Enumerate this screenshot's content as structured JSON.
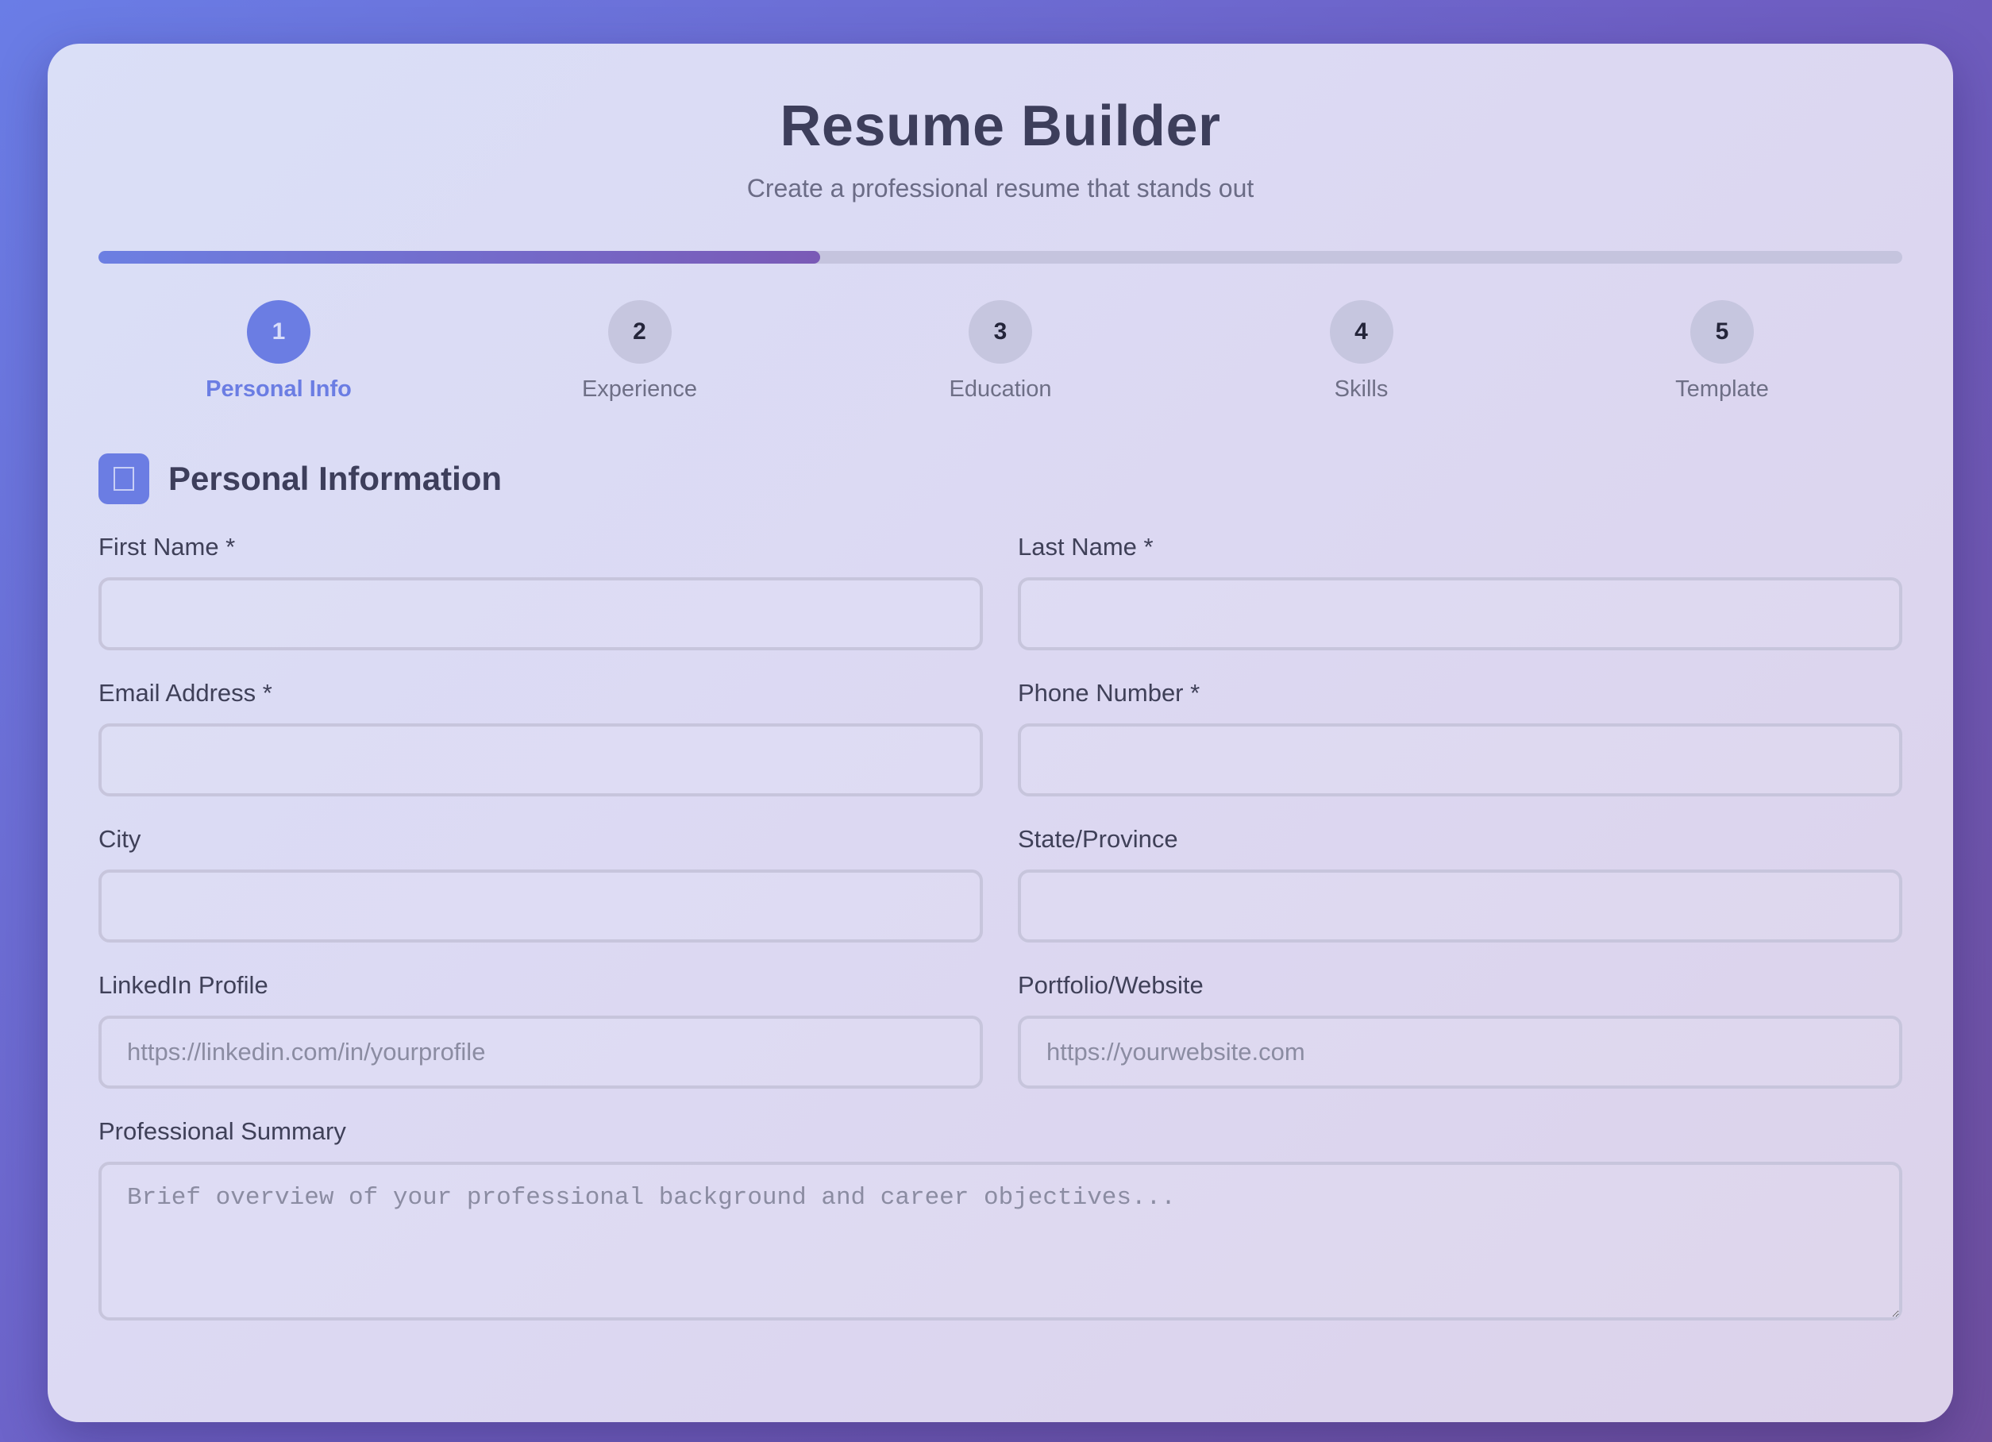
{
  "header": {
    "title": "Resume Builder",
    "subtitle": "Create a professional resume that stands out"
  },
  "progress": {
    "fraction": 0.4
  },
  "steps": [
    {
      "number": "1",
      "label": "Personal Info",
      "active": true
    },
    {
      "number": "2",
      "label": "Experience",
      "active": false
    },
    {
      "number": "3",
      "label": "Education",
      "active": false
    },
    {
      "number": "4",
      "label": "Skills",
      "active": false
    },
    {
      "number": "5",
      "label": "Template",
      "active": false
    }
  ],
  "section": {
    "title": "Personal Information",
    "icon": "user-icon"
  },
  "fields": {
    "first_name": {
      "label": "First Name *",
      "value": "",
      "placeholder": ""
    },
    "last_name": {
      "label": "Last Name *",
      "value": "",
      "placeholder": ""
    },
    "email": {
      "label": "Email Address *",
      "value": "",
      "placeholder": ""
    },
    "phone": {
      "label": "Phone Number *",
      "value": "",
      "placeholder": ""
    },
    "city": {
      "label": "City",
      "value": "",
      "placeholder": ""
    },
    "state": {
      "label": "State/Province",
      "value": "",
      "placeholder": ""
    },
    "linkedin": {
      "label": "LinkedIn Profile",
      "value": "",
      "placeholder": "https://linkedin.com/in/yourprofile"
    },
    "portfolio": {
      "label": "Portfolio/Website",
      "value": "",
      "placeholder": "https://yourwebsite.com"
    },
    "summary": {
      "label": "Professional Summary",
      "value": "",
      "placeholder": "Brief overview of your professional background and career objectives..."
    }
  },
  "colors": {
    "accent": "#6b7de3",
    "accent_end": "#7a5ab6",
    "text_dark": "#3d3e5b"
  }
}
